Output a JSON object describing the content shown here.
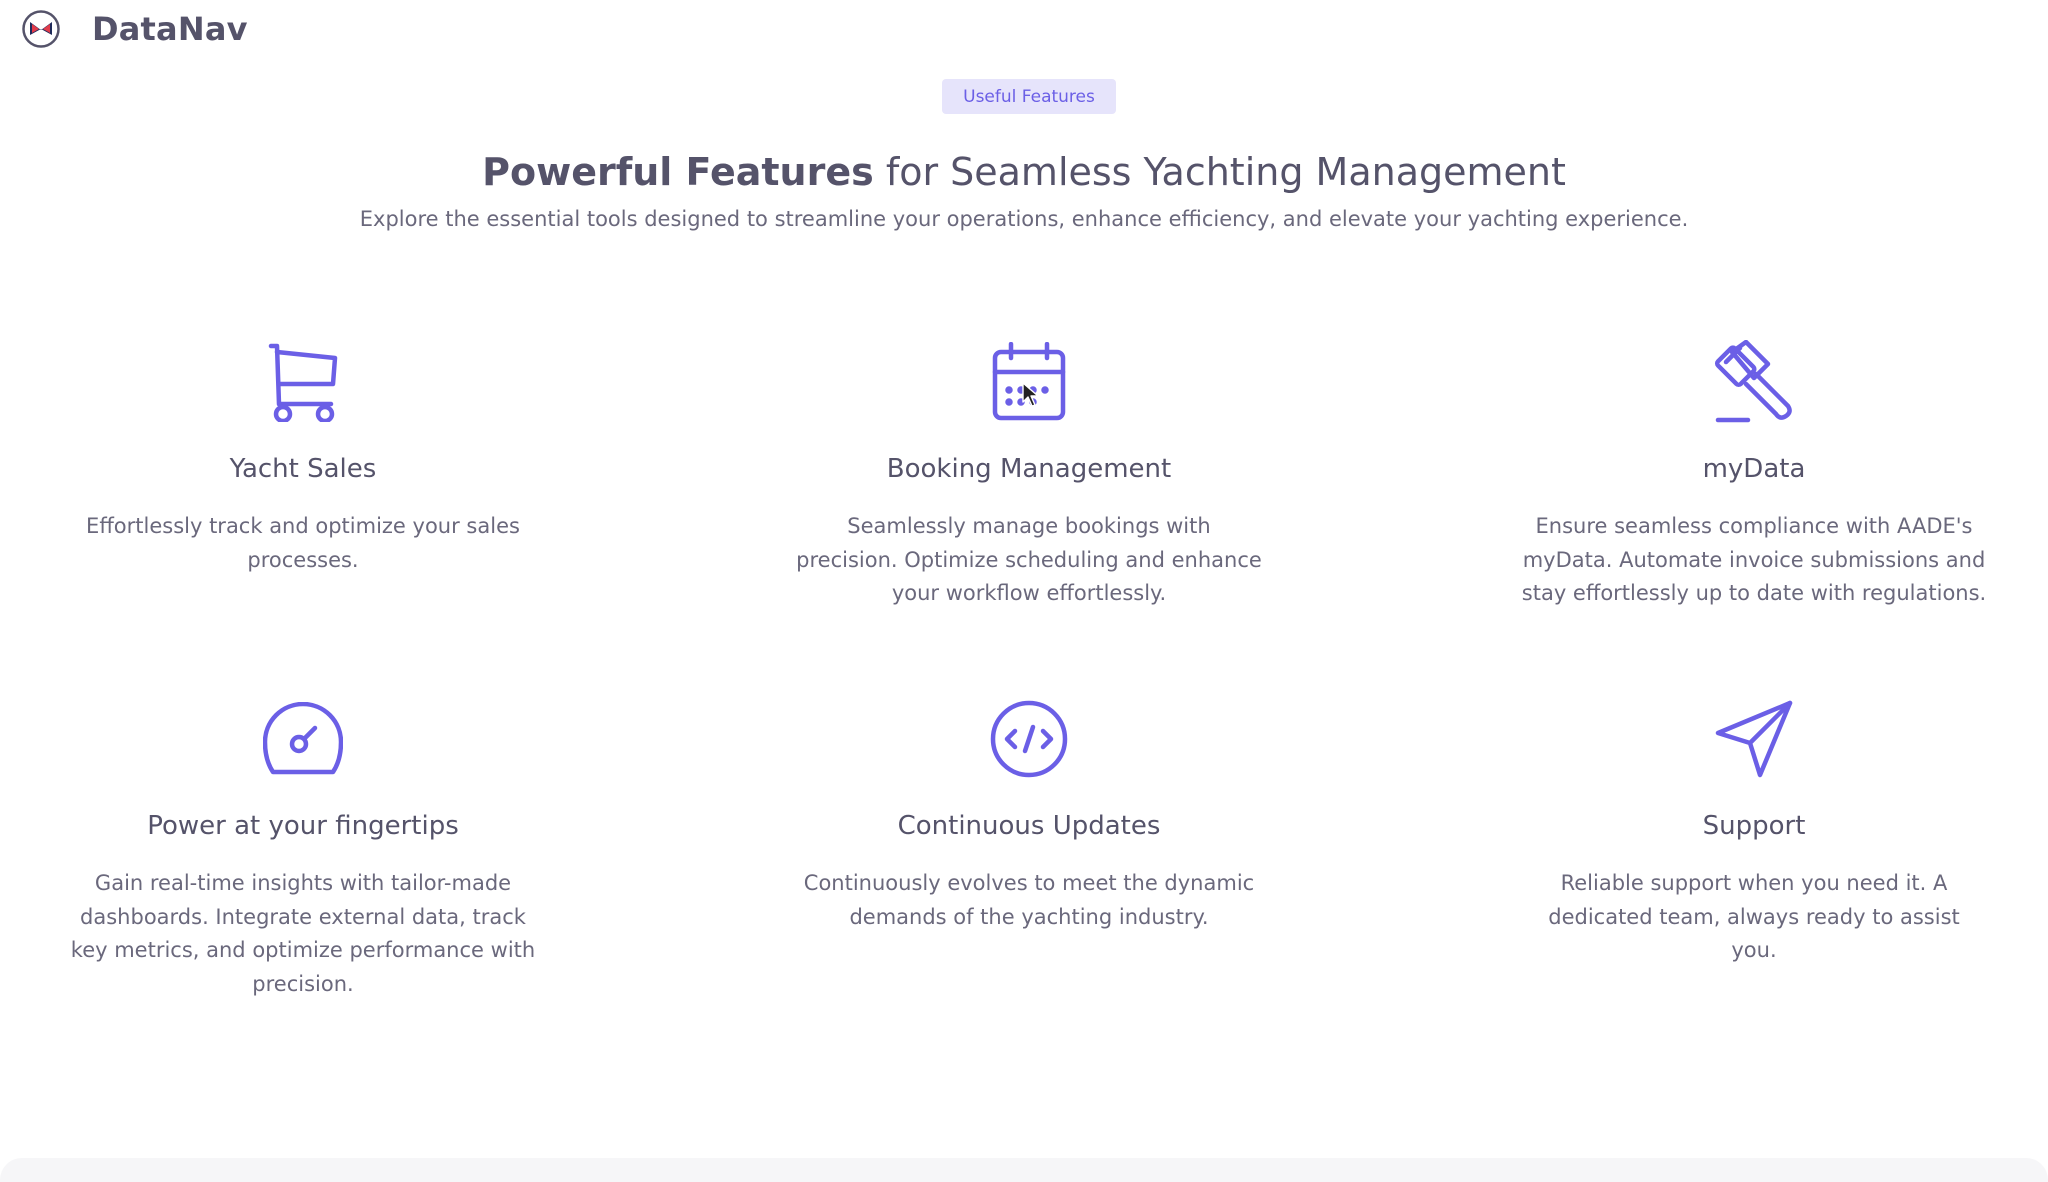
{
  "brand": {
    "name": "DataNav"
  },
  "badge": {
    "label": "Useful Features"
  },
  "hero": {
    "headline_emphasis": "Powerful Features",
    "headline_rest": " for Seamless Yachting Management",
    "subtitle": "Explore the essential tools designed to streamline your operations, enhance efficiency, and elevate your yachting experience."
  },
  "colors": {
    "accent": "#6b5fe6",
    "text": "#55536a",
    "badge_bg": "#e6e4fb"
  },
  "features": [
    {
      "icon": "shopping-cart-icon",
      "title": "Yacht Sales",
      "description": "Effortlessly track and optimize your sales processes."
    },
    {
      "icon": "calendar-icon",
      "title": "Booking Management",
      "description": "Seamlessly manage bookings with precision. Optimize scheduling and enhance your workflow effortlessly."
    },
    {
      "icon": "gavel-icon",
      "title": "myData",
      "description": "Ensure seamless compliance with AADE's myData. Automate invoice submissions and stay effortlessly up to date with regulations."
    },
    {
      "icon": "gauge-icon",
      "title": "Power at your fingertips",
      "description": "Gain real-time insights with tailor-made dashboards. Integrate external data, track key metrics, and optimize performance with precision."
    },
    {
      "icon": "code-icon",
      "title": "Continuous Updates",
      "description": "Continuously evolves to meet the dynamic demands of the yachting industry."
    },
    {
      "icon": "paper-plane-icon",
      "title": "Support",
      "description": "Reliable support when you need it. A dedicated team, always ready to assist you."
    }
  ]
}
